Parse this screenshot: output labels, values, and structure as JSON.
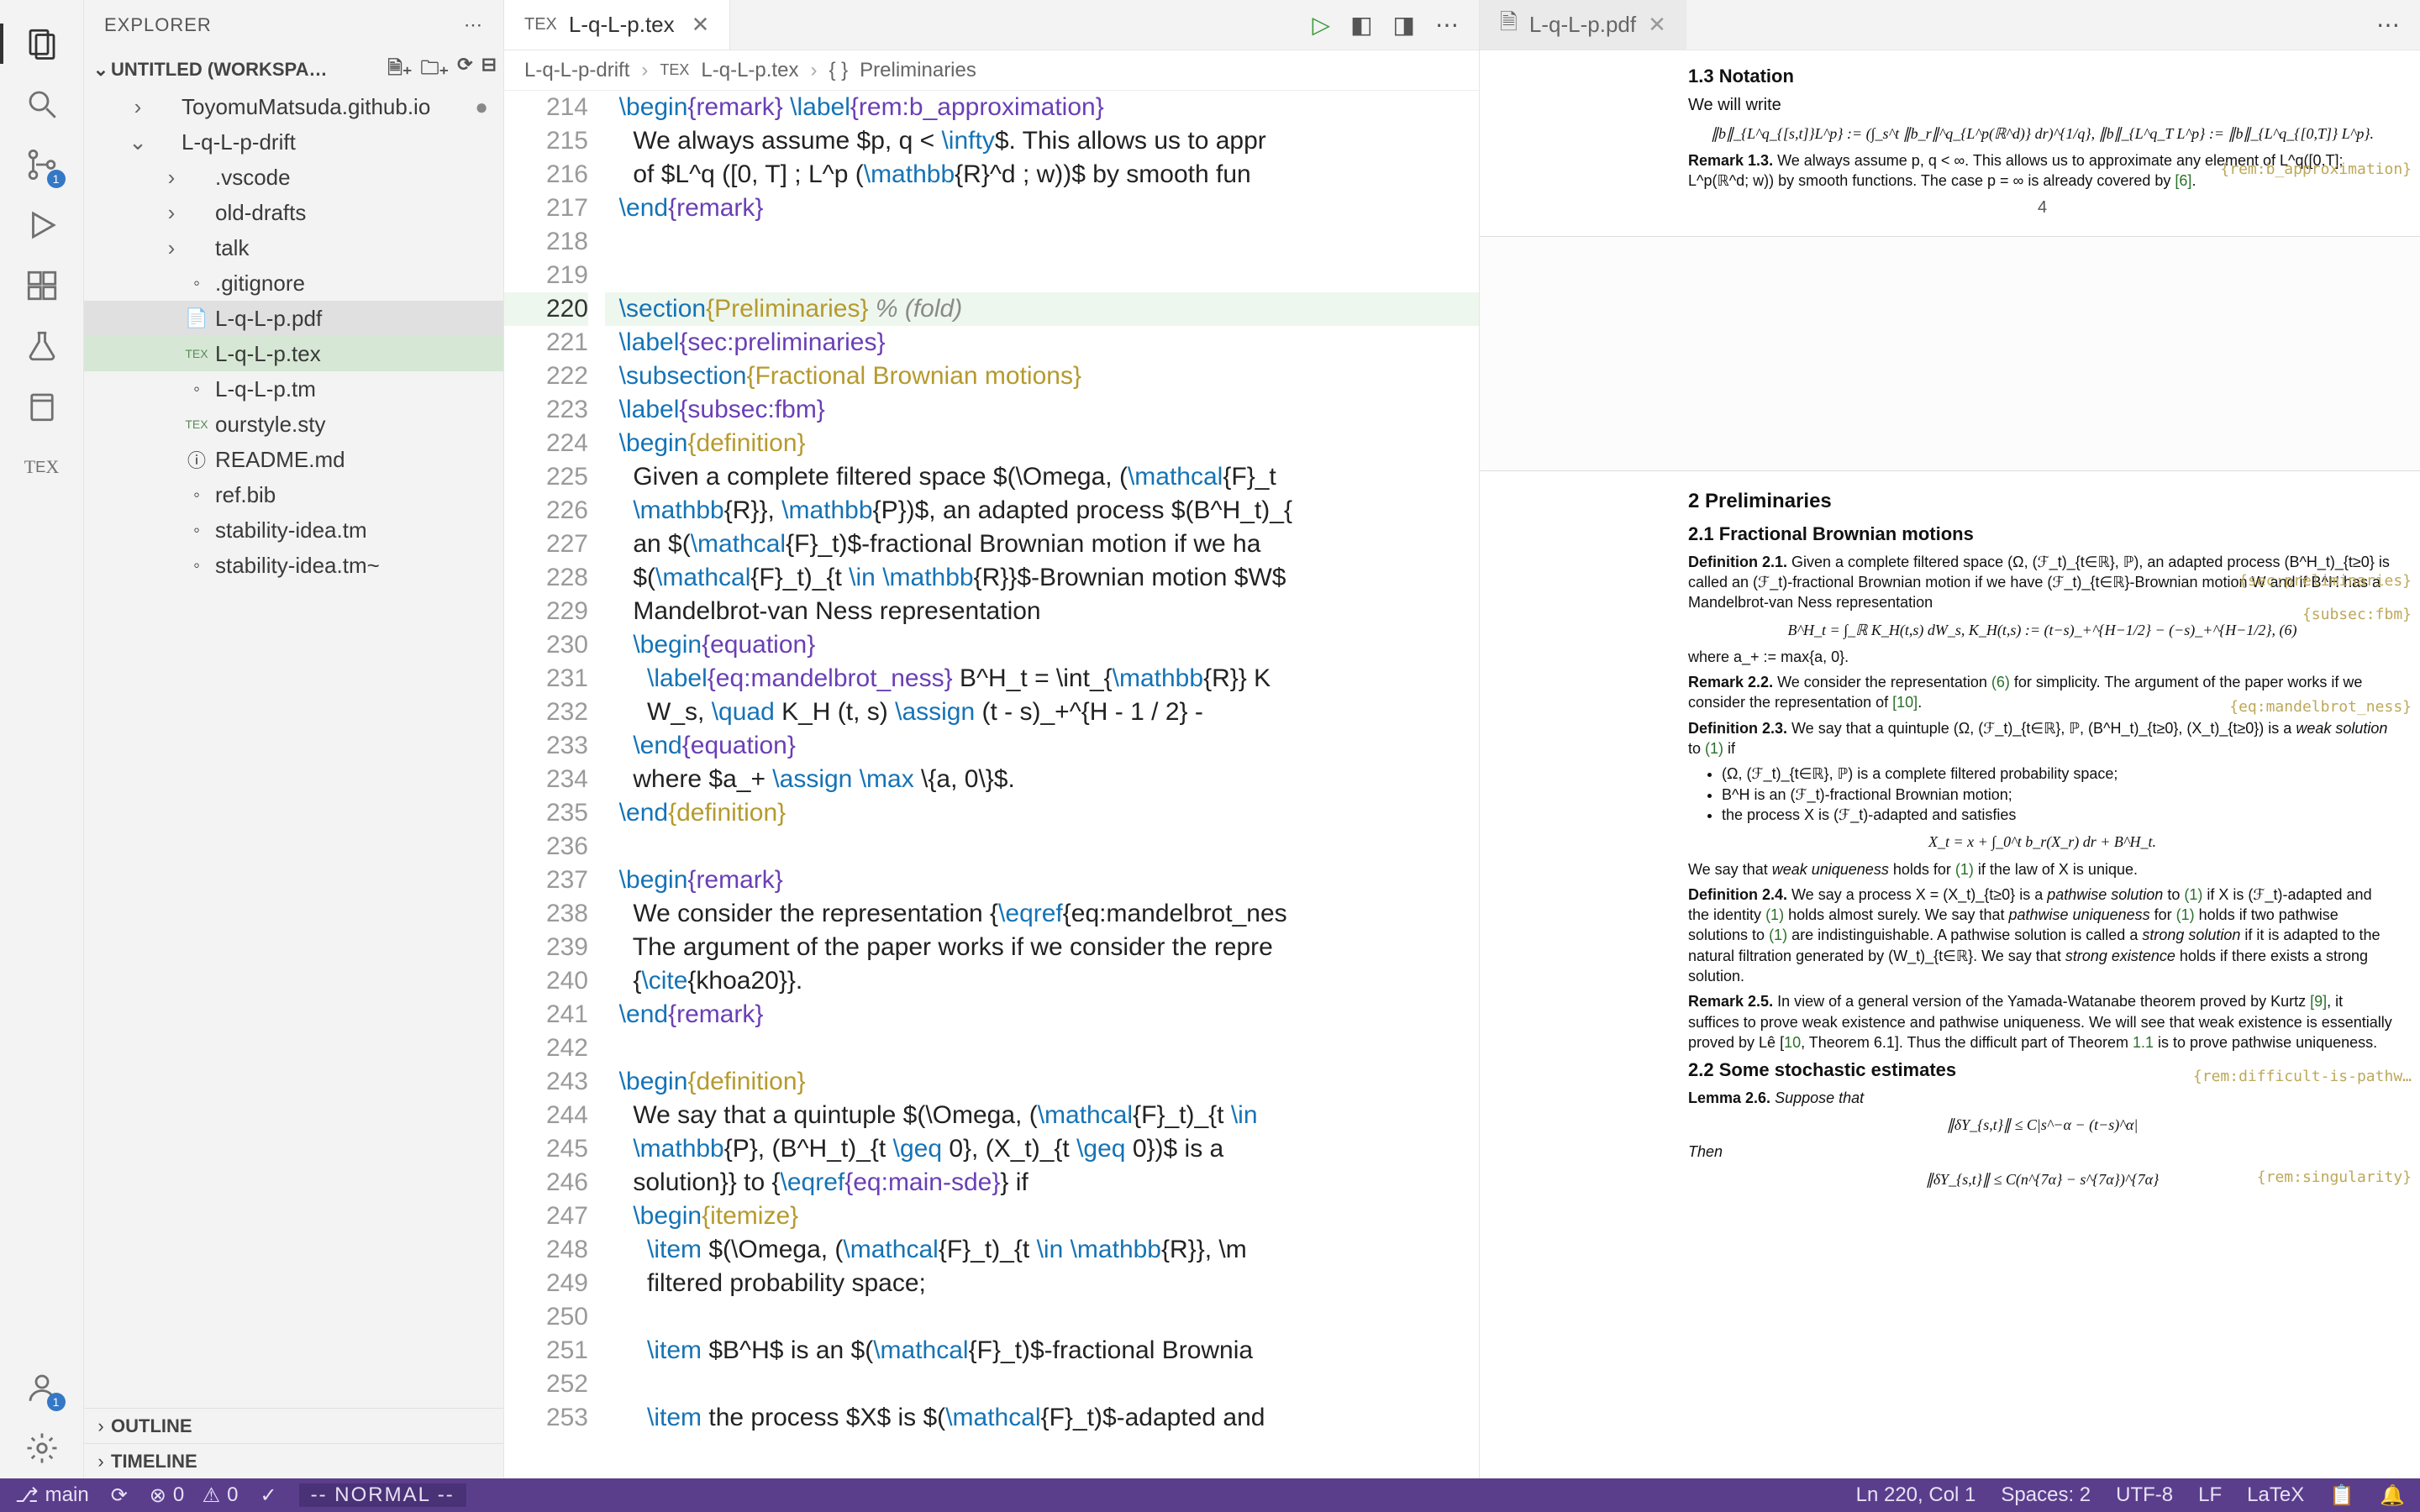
{
  "sidebar": {
    "title": "EXPLORER",
    "workspace": "UNTITLED (WORKSPA…",
    "outline": "OUTLINE",
    "timeline": "TIMELINE",
    "tree": [
      {
        "name": "ToyomuMatsuda.github.io",
        "depth": 1,
        "expandable": true,
        "dotted": true
      },
      {
        "name": "L-q-L-p-drift",
        "depth": 1,
        "expandable": true,
        "expanded": true
      },
      {
        "name": ".vscode",
        "depth": 2,
        "expandable": true
      },
      {
        "name": "old-drafts",
        "depth": 2,
        "expandable": true
      },
      {
        "name": "talk",
        "depth": 2,
        "expandable": true
      },
      {
        "name": ".gitignore",
        "depth": 2,
        "icon": "◦"
      },
      {
        "name": "L-q-L-p.pdf",
        "depth": 2,
        "icon": "📄",
        "hover": true
      },
      {
        "name": "L-q-L-p.tex",
        "depth": 2,
        "icon": "TEX",
        "selected": true
      },
      {
        "name": "L-q-L-p.tm",
        "depth": 2,
        "icon": "◦"
      },
      {
        "name": "ourstyle.sty",
        "depth": 2,
        "icon": "TEX"
      },
      {
        "name": "README.md",
        "depth": 2,
        "icon": "ⓘ"
      },
      {
        "name": "ref.bib",
        "depth": 2,
        "icon": "◦"
      },
      {
        "name": "stability-idea.tm",
        "depth": 2,
        "icon": "◦"
      },
      {
        "name": "stability-idea.tm~",
        "depth": 2,
        "icon": "◦"
      }
    ]
  },
  "activity_badges": {
    "scm": "1",
    "account": "1"
  },
  "editor": {
    "tab_icon": "TEX",
    "tab_name": "L-q-L-p.tex",
    "breadcrumb": [
      "L-q-L-p-drift",
      "L-q-L-p.tex",
      "Preliminaries"
    ],
    "breadcrumb_icons": [
      "",
      "TEX",
      "{}"
    ],
    "first_line_no": 214,
    "lines": [
      "  \\begin{remark} \\label{rem:b_approximation}",
      "    We always assume $p, q < \\infty$. This allows us to appr",
      "    of $L^q ([0, T] ; L^p (\\mathbb{R}^d ; w))$ by smooth fun",
      "  \\end{remark}",
      "",
      "",
      "  \\section{Preliminaries} % (fold)",
      "  \\label{sec:preliminaries}",
      "  \\subsection{Fractional Brownian motions}",
      "  \\label{subsec:fbm}",
      "  \\begin{definition}",
      "    Given a complete filtered space $(\\Omega, (\\mathcal{F}_t",
      "    \\mathbb{R}}, \\mathbb{P})$, an adapted process $(B^H_t)_{",
      "    an $(\\mathcal{F}_t)$-fractional Brownian motion if we ha",
      "    $(\\mathcal{F}_t)_{t \\in \\mathbb{R}}$-Brownian motion $W$",
      "    Mandelbrot-van Ness representation",
      "    \\begin{equation}",
      "      \\label{eq:mandelbrot_ness} B^H_t = \\int_{\\mathbb{R}} K",
      "      W_s, \\quad K_H (t, s) \\assign (t - s)_+^{H - 1 / 2} -",
      "    \\end{equation}",
      "    where $a_+ \\assign \\max \\{a, 0\\}$.",
      "  \\end{definition}",
      "",
      "  \\begin{remark}",
      "    We consider the representation {\\eqref{eq:mandelbrot_nes",
      "    The argument of the paper works if we consider the repre",
      "    {\\cite{khoa20}}.",
      "  \\end{remark}",
      "",
      "  \\begin{definition}",
      "    We say that a quintuple $(\\Omega, (\\mathcal{F}_t)_{t \\in",
      "    \\mathbb{P}, (B^H_t)_{t \\geq 0}, (X_t)_{t \\geq 0})$ is a",
      "    solution}} to {\\eqref{eq:main-sde}} if",
      "    \\begin{itemize}",
      "      \\item $(\\Omega, (\\mathcal{F}_t)_{t \\in \\mathbb{R}}, \\m",
      "      filtered probability space;",
      "",
      "      \\item $B^H$ is an $(\\mathcal{F}_t)$-fractional Brownia",
      "",
      "      \\item the process $X$ is $(\\mathcal{F}_t)$-adapted and"
    ],
    "highlight_index": 6
  },
  "preview": {
    "tab_name": "L-q-L-p.pdf",
    "page_number": "4",
    "content": {
      "sec13": "1.3   Notation",
      "p1": "We will write",
      "eq1": "∥b∥_{L^q_{[s,t]}L^p} := (∫_s^t ∥b_r∥^q_{L^p(ℝ^d)} dr)^{1/q},   ∥b∥_{L^q_T L^p} := ∥b∥_{L^q_{[0,T]} L^p}.",
      "rem13_a": "Remark 1.3.",
      "rem13_b": "  We always assume p, q < ∞. This allows us to approximate any element of L^q([0,T]; L^p(ℝ^d; w)) by smooth functions. The case p = ∞ is already covered by ",
      "rem13_c": "[6]",
      "rem13_d": ".",
      "sec2": "2   Preliminaries",
      "sec21": "2.1   Fractional Brownian motions",
      "def21_a": "Definition 2.1.",
      "def21_b": "  Given a complete filtered space (Ω, (ℱ_t)_{t∈ℝ}, ℙ), an adapted process (B^H_t)_{t≥0} is called an (ℱ_t)-fractional Brownian motion if we have (ℱ_t)_{t∈ℝ}-Brownian motion W and if B^H has a Mandelbrot-van Ness representation",
      "eq6": "B^H_t = ∫_ℝ K_H(t,s) dW_s,   K_H(t,s) := (t−s)_+^{H−1/2} − (−s)_+^{H−1/2},        (6)",
      "def21_c": "where a_+ := max{a, 0}.",
      "rem22_a": "Remark 2.2.",
      "rem22_b": "  We consider the representation ",
      "rem22_c": "(6)",
      "rem22_d": " for simplicity. The argument of the paper works if we consider the representation of ",
      "rem22_e": "[10]",
      "rem22_f": ".",
      "def23_a": "Definition 2.3.",
      "def23_b": "  We say that a quintuple (Ω, (ℱ_t)_{t∈ℝ}, ℙ, (B^H_t)_{t≥0}, (X_t)_{t≥0}) is a ",
      "def23_c": "weak solution",
      "def23_d": " to ",
      "def23_e": "(1)",
      "def23_f": " if",
      "b1": "(Ω, (ℱ_t)_{t∈ℝ}, ℙ) is a complete filtered probability space;",
      "b2": "B^H is an (ℱ_t)-fractional Brownian motion;",
      "b3": "the process X is (ℱ_t)-adapted and satisfies",
      "eqX": "X_t = x + ∫_0^t b_r(X_r) dr + B^H_t.",
      "pwu1": "We say that ",
      "pwu2": "weak uniqueness",
      "pwu3": " holds for ",
      "pwu4": "(1)",
      "pwu5": " if the law of X is unique.",
      "def24_a": "Definition 2.4.",
      "def24_b": "  We say a process X = (X_t)_{t≥0} is a ",
      "def24_c": "pathwise solution",
      "def24_d": " to ",
      "def24_e": "(1)",
      "def24_f": " if X is (ℱ_t)-adapted and the identity ",
      "def24_g": "(1)",
      "def24_h": " holds almost surely. We say that ",
      "def24_i": "pathwise uniqueness",
      "def24_j": " for ",
      "def24_k": "(1)",
      "def24_l": " holds if two pathwise solutions to ",
      "def24_m": "(1)",
      "def24_n": " are indistinguishable. A pathwise solution is called a ",
      "def24_o": "strong solution",
      "def24_p": " if it is adapted to the natural filtration generated by (W_t)_{t∈ℝ}. We say that ",
      "def24_q": "strong existence",
      "def24_r": " holds if there exists a strong solution.",
      "rem25_a": "Remark 2.5.",
      "rem25_b": "  In view of a general version of the Yamada-Watanabe theorem proved by Kurtz ",
      "rem25_c": "[9]",
      "rem25_d": ", it suffices to prove weak existence and pathwise uniqueness. We will see that weak existence is essentially proved by Lê [",
      "rem25_e": "10",
      "rem25_f": ", Theorem 6.1]. Thus the difficult part of Theorem ",
      "rem25_g": "1.1",
      "rem25_h": " is to prove pathwise uniqueness.",
      "sec22": "2.2   Some stochastic estimates",
      "lem26_a": "Lemma 2.6.",
      "lem26_b": "  Suppose that",
      "eqY": "∥δY_{s,t}∥ ≤ C|s^−α − (t−s)^α|",
      "then": "Then",
      "eqY2": "∥δY_{s,t}∥ ≤ C(n^{7α} − s^{7α})^{7α}",
      "labels": {
        "rembapprox": "{rem:b_approximation}",
        "secprelim": "{sec:preliminaries}",
        "subfbm": "{subsec:fbm}",
        "eqmandel": "{eq:mandelbrot_ness}",
        "remdiff": "{rem:difficult-is-pathw…",
        "remsing": "{rem:singularity}"
      }
    }
  },
  "status": {
    "branch": "main",
    "errors": "0",
    "warnings": "0",
    "mode": "-- NORMAL --",
    "position": "Ln 220, Col 1",
    "spaces": "Spaces: 2",
    "encoding": "UTF-8",
    "eol": "LF",
    "lang": "LaTeX"
  }
}
